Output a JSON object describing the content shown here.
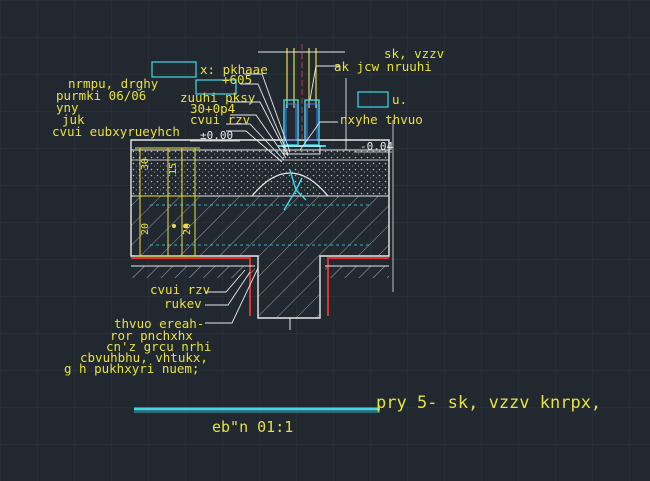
{
  "colors": {
    "background": "#212830",
    "grid": "#2c343d",
    "yellow": "#e6e040",
    "cyan": "#40d8e8",
    "white": "#e8e8e8",
    "red": "#e03030",
    "gray": "#a0a0a0",
    "blue": "#4080ff",
    "green": "#40c040"
  },
  "labels": {
    "top_right_1": "sk, vzzv",
    "top_right_2": "ak jcw nruuhi",
    "right_u": "u.",
    "right_nxyhe": "nxyhe thvuo",
    "level_right": "-0.04",
    "left_1": "x: pkhaae",
    "left_2": "+605",
    "left_3": "nrmpu, drghy",
    "left_4": "purmki 06/06",
    "left_5": "zuuhi pksy",
    "left_6": "yny",
    "left_7": "30+0p4",
    "left_8": "juk",
    "left_9": "cvui rzv",
    "left_10": "cvui eubxyrueyhch",
    "level_left": "±0.00",
    "dim_1": "30",
    "dim_2": "20",
    "dim_3": "15",
    "dim_4": "20",
    "bottom_1": "cvui rzv",
    "bottom_2": "rukev",
    "note_1": "thvuo ereah-",
    "note_2": "ror pnchxhx",
    "note_3": "cn'z grcu nrhi",
    "note_4": "cbvuhbhu, vhtukx,",
    "note_5": "g h pukhxyri nuem;",
    "title_main": "pry 5- sk, vzzv knrpx,",
    "title_scale": "eb\"n 01:1"
  }
}
